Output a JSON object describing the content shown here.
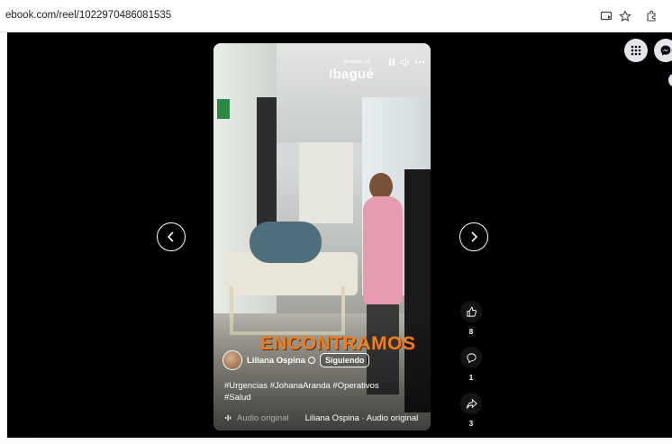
{
  "browser": {
    "url": "ebook.com/reel/1022970486081535",
    "icons": [
      "cast-icon",
      "star-icon",
      "extensions-icon"
    ]
  },
  "video": {
    "watermark_small": "Alcaldía de",
    "watermark": "Ibagué",
    "overlay_text": "ENCONTRAMOS",
    "controls": [
      "pause-icon",
      "volume-icon",
      "more-icon"
    ]
  },
  "author": {
    "name": "Liliana Ospina",
    "follow_label": "Siguiendo"
  },
  "caption": {
    "line1": "#Urgencias #JohanaAranda #Operativos",
    "line2": "#Salud"
  },
  "audio": {
    "text_a": "Audio original",
    "text_b": "Liliana Ospina · Audio original"
  },
  "actions": {
    "like_count": "8",
    "comment_count": "1",
    "share_count": "3"
  },
  "colors": {
    "overlay_text": "#f07d1f",
    "stage_background": "#000000"
  }
}
